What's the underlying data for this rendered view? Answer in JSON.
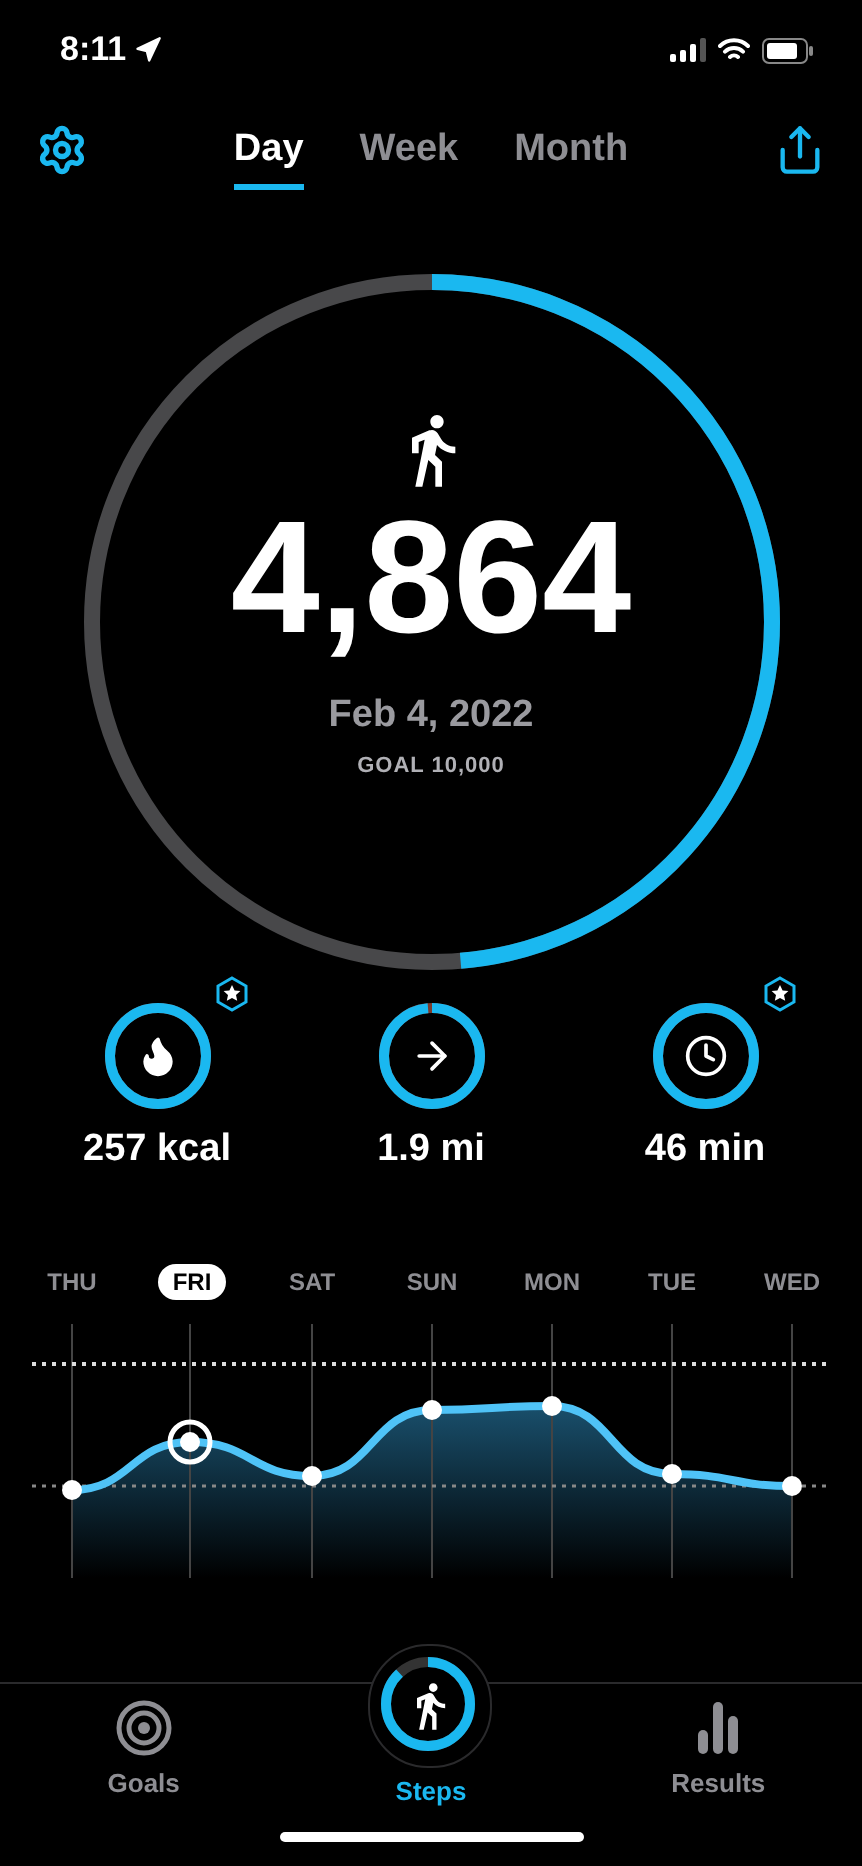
{
  "status_bar": {
    "time": "8:11"
  },
  "tabs": [
    {
      "label": "Day",
      "selected": true
    },
    {
      "label": "Week",
      "selected": false
    },
    {
      "label": "Month",
      "selected": false
    }
  ],
  "summary": {
    "steps": "4,864",
    "date": "Feb 4, 2022",
    "goal": "GOAL 10,000"
  },
  "metrics": [
    {
      "kind": "calories",
      "value": "257 kcal",
      "badge": true
    },
    {
      "kind": "distance",
      "value": "1.9 mi",
      "badge": false
    },
    {
      "kind": "time",
      "value": "46 min",
      "badge": true
    }
  ],
  "week": [
    {
      "label": "THU",
      "selected": false
    },
    {
      "label": "FRI",
      "selected": true
    },
    {
      "label": "SAT",
      "selected": false
    },
    {
      "label": "SUN",
      "selected": false
    },
    {
      "label": "MON",
      "selected": false
    },
    {
      "label": "TUE",
      "selected": false
    },
    {
      "label": "WED",
      "selected": false
    }
  ],
  "nav": [
    {
      "kind": "goals",
      "label": "Goals",
      "selected": false
    },
    {
      "kind": "steps",
      "label": "Steps",
      "selected": true
    },
    {
      "kind": "results",
      "label": "Results",
      "selected": false
    }
  ]
}
